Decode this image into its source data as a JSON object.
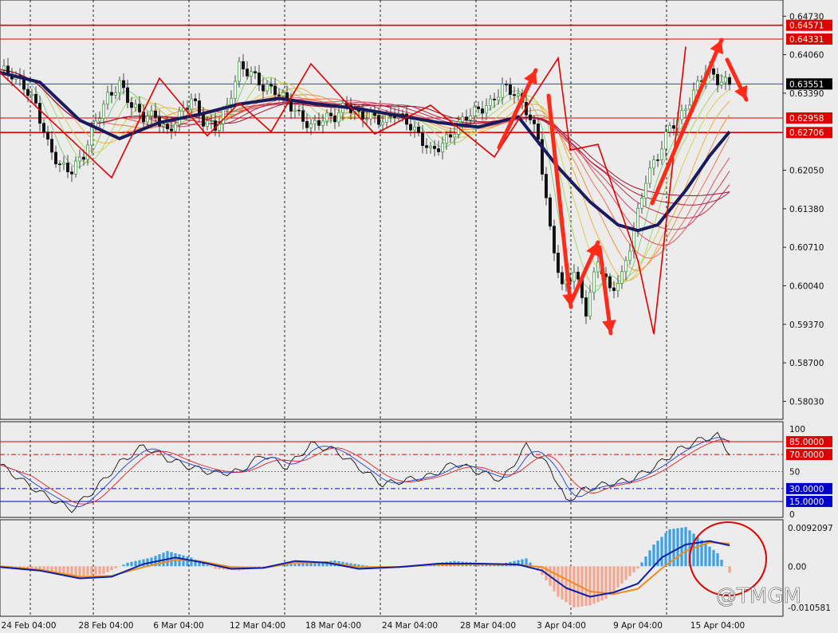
{
  "chart_data": {
    "type": "candlestick",
    "instrument_note": "",
    "x_tick_labels": [
      "24 Feb 04:00",
      "28 Feb 04:00",
      "6 Mar 04:00",
      "12 Mar 04:00",
      "18 Mar 04:00",
      "24 Mar 04:00",
      "28 Mar 04:00",
      "3 Apr 04:00",
      "9 Apr 04:00",
      "15 Apr 04:00"
    ],
    "price_panel": {
      "y_tick_labels": [
        "0.64730",
        "0.64060",
        "0.63390",
        "0.62050",
        "0.61380",
        "0.60710",
        "0.60040",
        "0.59370",
        "0.58700",
        "0.58030"
      ],
      "ylim": [
        0.578,
        0.649
      ],
      "horizontal_levels": [
        {
          "value": 0.64571,
          "label": "0.64571",
          "color": "#e00000"
        },
        {
          "value": 0.64331,
          "label": "0.64331",
          "color": "#e00000"
        },
        {
          "value": 0.62958,
          "label": "0.62958",
          "color": "#e00000"
        },
        {
          "value": 0.62706,
          "label": "0.62706",
          "color": "#e00000"
        }
      ],
      "current_price": {
        "value": 0.63551,
        "label": "0.63551",
        "color": "#0000cc"
      },
      "price_path": [
        [
          0,
          0.638
        ],
        [
          3,
          0.6372
        ],
        [
          6,
          0.6352
        ],
        [
          9,
          0.6318
        ],
        [
          12,
          0.625
        ],
        [
          15,
          0.6212
        ],
        [
          18,
          0.6205
        ],
        [
          21,
          0.6232
        ],
        [
          24,
          0.629
        ],
        [
          27,
          0.6332
        ],
        [
          30,
          0.6355
        ],
        [
          33,
          0.6318
        ],
        [
          36,
          0.6298
        ],
        [
          39,
          0.63
        ],
        [
          42,
          0.627
        ],
        [
          45,
          0.63
        ],
        [
          48,
          0.633
        ],
        [
          51,
          0.629
        ],
        [
          54,
          0.628
        ],
        [
          57,
          0.6315
        ],
        [
          60,
          0.6385
        ],
        [
          63,
          0.6374
        ],
        [
          66,
          0.635
        ],
        [
          69,
          0.6344
        ],
        [
          72,
          0.6325
        ],
        [
          75,
          0.63
        ],
        [
          78,
          0.628
        ],
        [
          81,
          0.6295
        ],
        [
          84,
          0.6298
        ],
        [
          87,
          0.632
        ],
        [
          90,
          0.63
        ],
        [
          93,
          0.63
        ],
        [
          96,
          0.629
        ],
        [
          99,
          0.6305
        ],
        [
          102,
          0.629
        ],
        [
          105,
          0.6265
        ],
        [
          108,
          0.6238
        ],
        [
          111,
          0.625
        ],
        [
          114,
          0.6275
        ],
        [
          117,
          0.63
        ],
        [
          120,
          0.631
        ],
        [
          123,
          0.632
        ],
        [
          126,
          0.635
        ],
        [
          129,
          0.634
        ],
        [
          132,
          0.631
        ],
        [
          135,
          0.626
        ],
        [
          138,
          0.61
        ],
        [
          141,
          0.6
        ],
        [
          144,
          0.603
        ],
        [
          147,
          0.596
        ],
        [
          150,
          0.605
        ],
        [
          153,
          0.5995
        ],
        [
          156,
          0.602
        ],
        [
          159,
          0.61
        ],
        [
          162,
          0.619
        ],
        [
          165,
          0.623
        ],
        [
          168,
          0.628
        ],
        [
          171,
          0.63
        ],
        [
          174,
          0.634
        ],
        [
          177,
          0.638
        ],
        [
          180,
          0.6362
        ],
        [
          183,
          0.6355
        ]
      ],
      "ma_slow": [
        [
          0,
          0.6375
        ],
        [
          10,
          0.6358
        ],
        [
          20,
          0.6292
        ],
        [
          30,
          0.626
        ],
        [
          40,
          0.6288
        ],
        [
          50,
          0.6302
        ],
        [
          60,
          0.632
        ],
        [
          70,
          0.633
        ],
        [
          80,
          0.632
        ],
        [
          90,
          0.6312
        ],
        [
          100,
          0.63
        ],
        [
          110,
          0.6288
        ],
        [
          120,
          0.628
        ],
        [
          130,
          0.6298
        ],
        [
          140,
          0.621
        ],
        [
          148,
          0.615
        ],
        [
          155,
          0.611
        ],
        [
          160,
          0.61
        ],
        [
          165,
          0.611
        ],
        [
          172,
          0.617
        ],
        [
          178,
          0.623
        ],
        [
          183,
          0.6272
        ]
      ],
      "zigzag": [
        [
          0,
          0.6375
        ],
        [
          28,
          0.6192
        ],
        [
          40,
          0.6365
        ],
        [
          52,
          0.6265
        ],
        [
          60,
          0.6322
        ],
        [
          68,
          0.6272
        ],
        [
          78,
          0.639
        ],
        [
          94,
          0.6268
        ],
        [
          108,
          0.6318
        ],
        [
          124,
          0.6228
        ],
        [
          140,
          0.64
        ],
        [
          143,
          0.624
        ],
        [
          150,
          0.625
        ],
        [
          160,
          0.6048
        ],
        [
          164,
          0.592
        ],
        [
          172,
          0.642
        ]
      ]
    },
    "rsi_panel": {
      "y_tick_labels": [
        "100",
        "50",
        "0"
      ],
      "levels": [
        {
          "value": 85,
          "label": "85.0000",
          "color": "#e00000"
        },
        {
          "value": 70,
          "label": "70.0000",
          "color": "#e00000"
        },
        {
          "value": 30,
          "label": "30.0000",
          "color": "#0000cc"
        },
        {
          "value": 15,
          "label": "15.0000",
          "color": "#0000cc"
        }
      ],
      "ylim": [
        0,
        100
      ],
      "series": [
        {
          "values": [
            [
              0,
              58
            ],
            [
              6,
              38
            ],
            [
              12,
              20
            ],
            [
              18,
              5
            ],
            [
              24,
              30
            ],
            [
              30,
              60
            ],
            [
              36,
              80
            ],
            [
              42,
              65
            ],
            [
              48,
              55
            ],
            [
              54,
              48
            ],
            [
              60,
              50
            ],
            [
              66,
              70
            ],
            [
              72,
              55
            ],
            [
              78,
              82
            ],
            [
              84,
              75
            ],
            [
              90,
              55
            ],
            [
              96,
              35
            ],
            [
              102,
              40
            ],
            [
              108,
              45
            ],
            [
              114,
              60
            ],
            [
              120,
              50
            ],
            [
              126,
              40
            ],
            [
              132,
              80
            ],
            [
              138,
              55
            ],
            [
              142,
              15
            ],
            [
              147,
              30
            ],
            [
              152,
              35
            ],
            [
              158,
              40
            ],
            [
              164,
              55
            ],
            [
              170,
              75
            ],
            [
              176,
              88
            ],
            [
              180,
              92
            ],
            [
              183,
              72
            ]
          ]
        }
      ]
    },
    "macd_panel": {
      "y_tick_labels": [
        "0.0092097",
        "0.00",
        "-0.010581"
      ],
      "ylim": [
        -0.010581,
        0.0092097
      ],
      "histogram": [
        [
          0,
          -0.0005
        ],
        [
          10,
          -0.0012
        ],
        [
          20,
          -0.0022
        ],
        [
          26,
          -0.0018
        ],
        [
          32,
          0.0008
        ],
        [
          38,
          0.002
        ],
        [
          42,
          0.0035
        ],
        [
          48,
          0.002
        ],
        [
          54,
          -0.0006
        ],
        [
          60,
          -0.001
        ],
        [
          66,
          -0.0003
        ],
        [
          72,
          0.0004
        ],
        [
          78,
          0.0008
        ],
        [
          84,
          0.0013
        ],
        [
          90,
          0.0004
        ],
        [
          96,
          -0.0004
        ],
        [
          102,
          -0.0003
        ],
        [
          108,
          0.0006
        ],
        [
          114,
          0.0012
        ],
        [
          120,
          0.0008
        ],
        [
          126,
          0.0006
        ],
        [
          132,
          0.0018
        ],
        [
          136,
          -0.002
        ],
        [
          140,
          -0.007
        ],
        [
          144,
          -0.0095
        ],
        [
          148,
          -0.009
        ],
        [
          152,
          -0.0075
        ],
        [
          156,
          -0.004
        ],
        [
          160,
          -0.0005
        ],
        [
          164,
          0.005
        ],
        [
          168,
          0.0085
        ],
        [
          172,
          0.009
        ],
        [
          176,
          0.006
        ],
        [
          180,
          0.003
        ],
        [
          183,
          -0.0015
        ]
      ],
      "macd_line": [
        [
          0,
          -0.0002
        ],
        [
          10,
          -0.001
        ],
        [
          20,
          -0.0028
        ],
        [
          28,
          -0.0024
        ],
        [
          36,
          0.0005
        ],
        [
          44,
          0.002
        ],
        [
          50,
          0.001
        ],
        [
          58,
          -0.0006
        ],
        [
          66,
          -0.0004
        ],
        [
          74,
          0.0012
        ],
        [
          82,
          0.0008
        ],
        [
          90,
          -0.0006
        ],
        [
          100,
          -0.0002
        ],
        [
          110,
          0.0006
        ],
        [
          120,
          0.0006
        ],
        [
          130,
          0.0004
        ],
        [
          136,
          -0.001
        ],
        [
          142,
          -0.005
        ],
        [
          148,
          -0.007
        ],
        [
          154,
          -0.006
        ],
        [
          160,
          -0.004
        ],
        [
          166,
          0.002
        ],
        [
          172,
          0.005
        ],
        [
          178,
          0.0058
        ],
        [
          183,
          0.0048
        ]
      ],
      "signal_line": [
        [
          0,
          0.0
        ],
        [
          10,
          -0.0008
        ],
        [
          20,
          -0.0024
        ],
        [
          28,
          -0.0022
        ],
        [
          36,
          -0.0002
        ],
        [
          44,
          0.0015
        ],
        [
          50,
          0.0012
        ],
        [
          58,
          -0.0002
        ],
        [
          66,
          -0.0004
        ],
        [
          74,
          0.0008
        ],
        [
          82,
          0.0009
        ],
        [
          90,
          -0.0002
        ],
        [
          100,
          -0.0002
        ],
        [
          110,
          0.0004
        ],
        [
          120,
          0.0005
        ],
        [
          130,
          0.0003
        ],
        [
          136,
          -0.0002
        ],
        [
          142,
          -0.003
        ],
        [
          148,
          -0.0058
        ],
        [
          154,
          -0.0064
        ],
        [
          160,
          -0.0052
        ],
        [
          166,
          -0.0005
        ],
        [
          172,
          0.0035
        ],
        [
          178,
          0.0055
        ],
        [
          183,
          0.0052
        ]
      ]
    }
  },
  "watermark": {
    "text": "@TMGM"
  },
  "colors": {
    "background": "#ececec",
    "level_red": "#e00000",
    "level_blue": "#0000cc",
    "zigzag": "#e00000",
    "ma_slow": "#1a1a5e",
    "hist_up": "#3aa0e8",
    "hist_down": "#f4a58c",
    "macd_line": "#0b1fa8",
    "signal_line": "#f08a1a",
    "candle_up": "#2b9a2b",
    "candle_down": "#111111",
    "arrow": "#ff2a1a"
  }
}
